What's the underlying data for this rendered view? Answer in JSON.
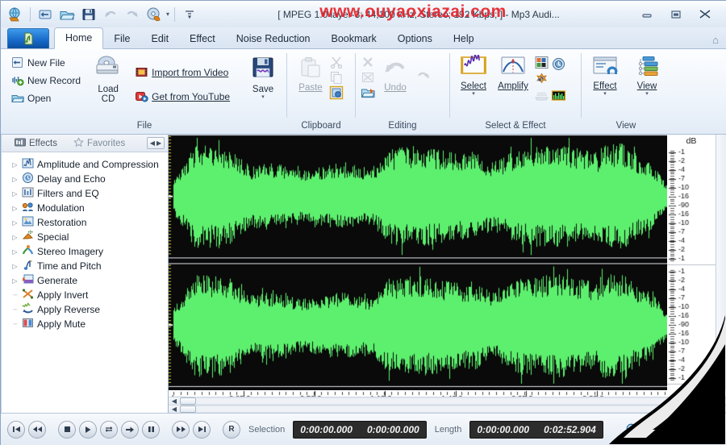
{
  "window": {
    "title": "[ MPEG 1.0 layer-3; 44,100 kHz; Stereo; 192 Kbps; ]  - Mp3 Audi...",
    "watermark": "www.ouyaoxiazai.com",
    "minimize": "–",
    "maximize": "❐",
    "close": "✕"
  },
  "quick_access": [
    {
      "name": "app-options-icon",
      "title": "Options"
    },
    {
      "name": "import-icon",
      "title": "Import"
    },
    {
      "name": "open-icon",
      "title": "Open"
    },
    {
      "name": "save-icon",
      "title": "Save"
    },
    {
      "name": "undo-icon",
      "title": "Undo"
    },
    {
      "name": "redo-icon",
      "title": "Redo"
    },
    {
      "name": "burn-cd-icon",
      "title": "Burn CD"
    },
    {
      "name": "customize-qat-icon",
      "title": "Customize Quick Access Toolbar"
    }
  ],
  "tabs": [
    {
      "label": "Home",
      "active": true
    },
    {
      "label": "File",
      "active": false
    },
    {
      "label": "Edit",
      "active": false
    },
    {
      "label": "Effect",
      "active": false
    },
    {
      "label": "Noise Reduction",
      "active": false
    },
    {
      "label": "Bookmark",
      "active": false
    },
    {
      "label": "Options",
      "active": false
    },
    {
      "label": "Help",
      "active": false
    }
  ],
  "ribbon": {
    "groups": [
      {
        "label": "File",
        "items": [
          {
            "label": "New File",
            "icon": "new-file-icon",
            "underline": "N"
          },
          {
            "label": "New Record",
            "icon": "new-record-icon",
            "underline": "R"
          },
          {
            "label": "Open",
            "icon": "open-folder-icon",
            "underline": "O"
          },
          {
            "label": "Load CD",
            "icon": "load-cd-icon"
          },
          {
            "label": "Import from Video",
            "icon": "import-video-icon",
            "underline": "I"
          },
          {
            "label": "Get from YouTube",
            "icon": "youtube-icon",
            "underline": "G"
          },
          {
            "label": "Save",
            "icon": "save-big-icon",
            "underline": "S"
          }
        ]
      },
      {
        "label": "Clipboard",
        "items": [
          {
            "label": "Paste",
            "icon": "paste-icon",
            "disabled": true
          },
          {
            "label": "",
            "icon": "cut-icon",
            "disabled": true
          },
          {
            "label": "",
            "icon": "copy-icon",
            "disabled": true
          },
          {
            "label": "",
            "icon": "paste-special-icon",
            "disabled": false
          }
        ]
      },
      {
        "label": "Editing",
        "items": [
          {
            "label": "",
            "icon": "delete-icon",
            "disabled": true
          },
          {
            "label": "",
            "icon": "trim-icon",
            "disabled": true
          },
          {
            "label": "",
            "icon": "insert-file-icon",
            "disabled": false
          },
          {
            "label": "Undo",
            "icon": "undo-big-icon",
            "disabled": true,
            "underline": "U"
          },
          {
            "label": "",
            "icon": "redo-big-icon",
            "disabled": true
          }
        ]
      },
      {
        "label": "Select & Effect",
        "items": [
          {
            "label": "Select",
            "icon": "select-icon",
            "underline": "S"
          },
          {
            "label": "Amplify",
            "icon": "amplify-icon",
            "underline": "A"
          },
          {
            "label": "",
            "icon": "equalizer-icon"
          },
          {
            "label": "",
            "icon": "delay-echo-icon"
          },
          {
            "label": "",
            "icon": "modulation-icon"
          },
          {
            "label": "",
            "icon": "fade-icon",
            "disabled": true
          },
          {
            "label": "",
            "icon": "spectrum-icon"
          }
        ]
      },
      {
        "label": "View",
        "items": [
          {
            "label": "Effect",
            "icon": "effect-panel-icon",
            "underline": "E"
          },
          {
            "label": "View",
            "icon": "view-list-icon",
            "underline": "V"
          }
        ]
      }
    ]
  },
  "left_panel": {
    "tabs": [
      {
        "label": "Effects",
        "icon": "effects-icon",
        "selected": true
      },
      {
        "label": "Favorites",
        "icon": "star-icon",
        "selected": false
      }
    ],
    "nav_prev": "◀",
    "nav_next": "▶",
    "tree": [
      {
        "label": "Amplitude and Compression",
        "icon": "amplitude-icon",
        "expandable": true
      },
      {
        "label": "Delay and Echo",
        "icon": "delay-icon",
        "expandable": true
      },
      {
        "label": "Filters and EQ",
        "icon": "filters-icon",
        "expandable": true
      },
      {
        "label": "Modulation",
        "icon": "modulation-icon",
        "expandable": true
      },
      {
        "label": "Restoration",
        "icon": "restoration-icon",
        "expandable": true
      },
      {
        "label": "Special",
        "icon": "special-icon",
        "expandable": true
      },
      {
        "label": "Stereo Imagery",
        "icon": "stereo-icon",
        "expandable": true
      },
      {
        "label": "Time and Pitch",
        "icon": "time-pitch-icon",
        "expandable": true
      },
      {
        "label": "Generate",
        "icon": "generate-icon",
        "expandable": true
      },
      {
        "label": "Apply Invert",
        "icon": "invert-icon",
        "expandable": false
      },
      {
        "label": "Apply Reverse",
        "icon": "reverse-icon",
        "expandable": false
      },
      {
        "label": "Apply Mute",
        "icon": "mute-icon",
        "expandable": false
      }
    ]
  },
  "waveform": {
    "db_header": "dB",
    "db_ticks": [
      "-1",
      "-2",
      "-4",
      "-7",
      "-10",
      "-16",
      "-90",
      "-16",
      "-10",
      "-7",
      "-4",
      "-2",
      "-1"
    ],
    "wave_color": "#5df06e",
    "background_color": "#0a0a0a",
    "ruler_unit": "hms",
    "ruler_labels": [
      "0:25.0",
      "0:50.0",
      "1:15.0",
      "1:40.0",
      "2:05.0",
      "2:30.0"
    ]
  },
  "statusbar": {
    "transport": [
      {
        "name": "go-start-button",
        "glyph": "|◀"
      },
      {
        "name": "rewind-button",
        "glyph": "◀◀"
      },
      {
        "name": "stop-button",
        "glyph": "■"
      },
      {
        "name": "play-button",
        "glyph": "▶"
      },
      {
        "name": "loop-button",
        "glyph": "⇄"
      },
      {
        "name": "play-selection-button",
        "glyph": "➡"
      },
      {
        "name": "pause-button",
        "glyph": "❚❚"
      },
      {
        "name": "fast-forward-button",
        "glyph": "▶▶"
      },
      {
        "name": "go-end-button",
        "glyph": "▶|"
      },
      {
        "name": "record-button",
        "glyph": "R"
      }
    ],
    "selection_label": "Selection",
    "selection_start": "0:00:00.000",
    "selection_end": "0:00:00.000",
    "length_label": "Length",
    "length_current": "0:00:00.000",
    "length_total": "0:02:52.904",
    "zoom_in": "zoom-in-icon",
    "zoom_out": "zoom-out-icon"
  }
}
